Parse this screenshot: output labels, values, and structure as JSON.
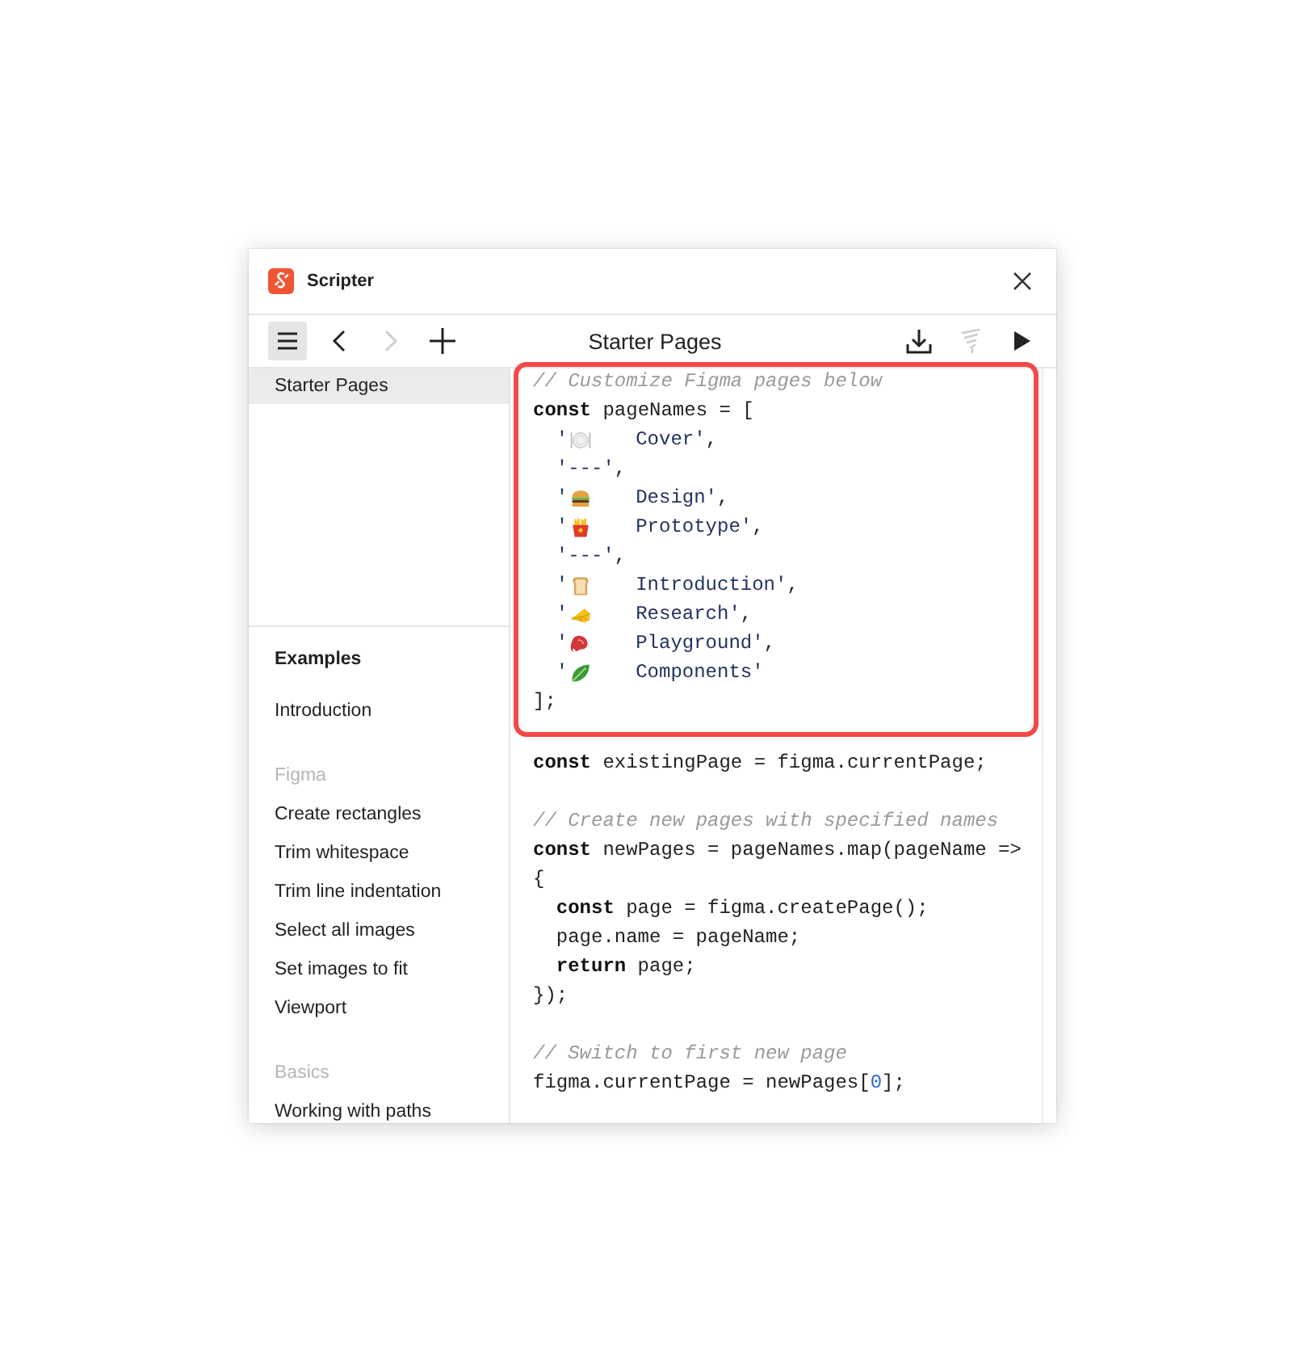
{
  "title_bar": {
    "title": "Scripter"
  },
  "toolbar": {
    "left": [
      {
        "kind": "menu",
        "active": true,
        "disabled": false
      },
      {
        "kind": "back",
        "active": false,
        "disabled": false
      },
      {
        "kind": "forward",
        "active": false,
        "disabled": true
      },
      {
        "kind": "add",
        "active": false,
        "disabled": false
      }
    ],
    "title": "Starter Pages",
    "right": [
      {
        "kind": "download",
        "active": false,
        "disabled": false
      },
      {
        "kind": "tornado",
        "active": false,
        "disabled": true
      },
      {
        "kind": "play",
        "active": false,
        "disabled": false
      }
    ]
  },
  "sidebar": {
    "scripts": [
      {
        "label": "Starter Pages",
        "selected": true
      }
    ],
    "examples_title": "Examples",
    "groups": [
      {
        "items": [
          {
            "label": "Introduction",
            "selected": false
          }
        ]
      },
      {
        "heading": "Figma",
        "items": [
          {
            "label": "Create rectangles",
            "selected": false
          },
          {
            "label": "Trim whitespace",
            "selected": false
          },
          {
            "label": "Trim line indentation",
            "selected": false
          },
          {
            "label": "Select all images",
            "selected": false
          },
          {
            "label": "Set images to fit",
            "selected": false
          },
          {
            "label": "Viewport",
            "selected": false
          }
        ]
      },
      {
        "heading": "Basics",
        "items": [
          {
            "label": "Working with paths",
            "selected": false
          }
        ]
      }
    ]
  },
  "code": {
    "blocks": [
      {
        "highlighted": true,
        "lines": [
          {
            "indented": false,
            "tokens": [
              {
                "kind": "comment",
                "text": "// Customize Figma pages below"
              }
            ]
          },
          {
            "indented": false,
            "tokens": [
              {
                "kind": "keyword",
                "text": "const"
              },
              {
                "kind": "plain",
                "text": " pageNames = ["
              }
            ]
          },
          {
            "indented": true,
            "tokens": [
              {
                "kind": "string",
                "text": "'"
              },
              {
                "kind": "emoji"
              },
              {
                "kind": "string",
                "text": "Cover'"
              },
              {
                "kind": "plain",
                "text": ","
              }
            ]
          },
          {
            "indented": true,
            "tokens": [
              {
                "kind": "string",
                "text": "'---'"
              },
              {
                "kind": "plain",
                "text": ","
              }
            ]
          },
          {
            "indented": true,
            "tokens": [
              {
                "kind": "string",
                "text": "'"
              },
              {
                "kind": "emoji"
              },
              {
                "kind": "string",
                "text": "Design'"
              },
              {
                "kind": "plain",
                "text": ","
              }
            ]
          },
          {
            "indented": true,
            "tokens": [
              {
                "kind": "string",
                "text": "'"
              },
              {
                "kind": "emoji"
              },
              {
                "kind": "string",
                "text": "Prototype'"
              },
              {
                "kind": "plain",
                "text": ","
              }
            ]
          },
          {
            "indented": true,
            "tokens": [
              {
                "kind": "string",
                "text": "'---'"
              },
              {
                "kind": "plain",
                "text": ","
              }
            ]
          },
          {
            "indented": true,
            "tokens": [
              {
                "kind": "string",
                "text": "'"
              },
              {
                "kind": "emoji"
              },
              {
                "kind": "string",
                "text": "Introduction'"
              },
              {
                "kind": "plain",
                "text": ","
              }
            ]
          },
          {
            "indented": true,
            "tokens": [
              {
                "kind": "string",
                "text": "'"
              },
              {
                "kind": "emoji"
              },
              {
                "kind": "string",
                "text": "Research'"
              },
              {
                "kind": "plain",
                "text": ","
              }
            ]
          },
          {
            "indented": true,
            "tokens": [
              {
                "kind": "string",
                "text": "'"
              },
              {
                "kind": "emoji"
              },
              {
                "kind": "string",
                "text": "Playground'"
              },
              {
                "kind": "plain",
                "text": ","
              }
            ]
          },
          {
            "indented": true,
            "tokens": [
              {
                "kind": "string",
                "text": "'"
              },
              {
                "kind": "emoji"
              },
              {
                "kind": "string",
                "text": "Components'"
              }
            ]
          },
          {
            "indented": false,
            "tokens": [
              {
                "kind": "plain",
                "text": "];"
              }
            ]
          }
        ]
      },
      {
        "highlighted": false,
        "lines": [
          {
            "indented": false,
            "tokens": [
              {
                "kind": "keyword",
                "text": "const"
              },
              {
                "kind": "plain",
                "text": " existingPage = figma.currentPage;"
              }
            ]
          }
        ]
      },
      {
        "highlighted": false,
        "lines": [
          {
            "indented": false,
            "tokens": [
              {
                "kind": "comment",
                "text": "// Create new pages with specified names"
              }
            ]
          },
          {
            "indented": false,
            "tokens": [
              {
                "kind": "keyword",
                "text": "const"
              },
              {
                "kind": "plain",
                "text": " newPages = pageNames.map(pageName =>"
              }
            ]
          },
          {
            "indented": false,
            "tokens": [
              {
                "kind": "plain",
                "text": "{"
              }
            ]
          },
          {
            "indented": true,
            "tokens": [
              {
                "kind": "keyword",
                "text": "const"
              },
              {
                "kind": "plain",
                "text": " page = figma.createPage();"
              }
            ]
          },
          {
            "indented": true,
            "tokens": [
              {
                "kind": "plain",
                "text": "page.name = pageName;"
              }
            ]
          },
          {
            "indented": true,
            "tokens": [
              {
                "kind": "keyword",
                "text": "return"
              },
              {
                "kind": "plain",
                "text": " page;"
              }
            ]
          },
          {
            "indented": false,
            "tokens": [
              {
                "kind": "plain",
                "text": "});"
              }
            ]
          }
        ]
      },
      {
        "highlighted": false,
        "lines": [
          {
            "indented": false,
            "tokens": [
              {
                "kind": "comment",
                "text": "// Switch to first new page"
              }
            ]
          },
          {
            "indented": false,
            "tokens": [
              {
                "kind": "plain",
                "text": "figma.currentPage = newPages["
              },
              {
                "kind": "number",
                "text": "0"
              },
              {
                "kind": "plain",
                "text": "];"
              }
            ]
          }
        ]
      }
    ]
  }
}
